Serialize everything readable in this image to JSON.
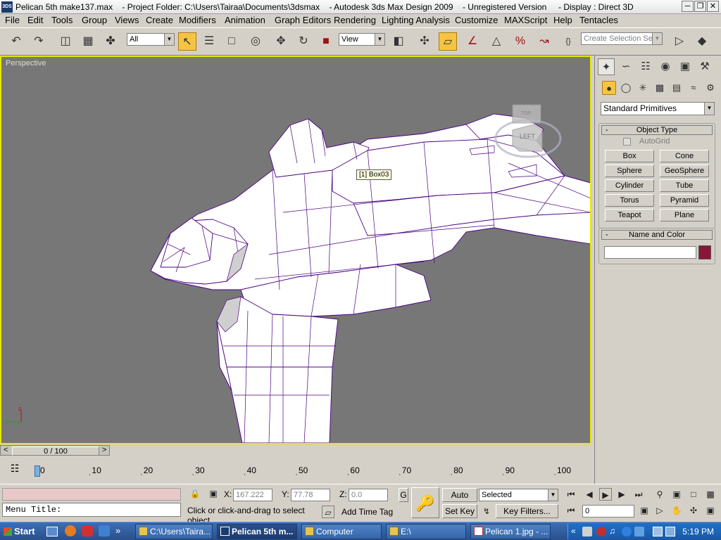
{
  "window": {
    "app_icon": "3DS",
    "title": "Pelican 5th make137.max    - Project Folder: C:\\Users\\Tairaa\\Documents\\3dsmax    - Autodesk 3ds Max Design 2009    - Unregistered Version     - Display : Direct 3D"
  },
  "menu": [
    "File",
    "Edit",
    "Tools",
    "Group",
    "Views",
    "Create",
    "Modifiers",
    "Animation",
    "Graph Editors",
    "Rendering",
    "Lighting Analysis",
    "Customize",
    "MAXScript",
    "Help",
    "Tentacles"
  ],
  "toolbar": {
    "selection_filter": "All",
    "ref_coord": "View",
    "named_selection_placeholder": "Create Selection Set",
    "icons": [
      "undo-icon",
      "redo-icon",
      "select-link-icon",
      "unlink-icon",
      "bind-spacewarp-icon",
      "select-object-icon",
      "select-by-name-icon",
      "rect-region-icon",
      "window-crossing-icon",
      "move-icon",
      "rotate-icon",
      "scale-icon",
      "pivot-icon",
      "manipulate-icon",
      "snap-toggle-icon",
      "angle-snap-icon",
      "percent-snap-icon",
      "spinner-snap-icon",
      "edit-named-sel-icon",
      "mirror-icon",
      "align-icon"
    ]
  },
  "viewport": {
    "label": "Perspective",
    "tooltip": "[1] Box03",
    "gizmo_z": "z",
    "gizmo_y": "y",
    "viewcube_face": "LEFT",
    "viewcube_top": "TOP"
  },
  "command_panel": {
    "category": "Standard Primitives",
    "object_type_header": "Object Type",
    "autogrid_label": "AutoGrid",
    "autogrid_checked": false,
    "buttons": [
      "Box",
      "Cone",
      "Sphere",
      "GeoSphere",
      "Cylinder",
      "Tube",
      "Torus",
      "Pyramid",
      "Teapot",
      "Plane"
    ],
    "name_color_header": "Name and Color",
    "object_name": "",
    "object_color": "#8b1538",
    "collapse_symbol": "-"
  },
  "timeline": {
    "frame_display": "0 / 100",
    "ticks": [
      "0",
      "10",
      "20",
      "30",
      "40",
      "50",
      "60",
      "70",
      "80",
      "90",
      "100"
    ],
    "prev_arrow": "<",
    "next_arrow": ">"
  },
  "status": {
    "maxscript_label": "Menu Title:",
    "x_label": "X:",
    "x_value": "167.222",
    "y_label": "Y:",
    "y_value": "77.78",
    "z_label": "Z:",
    "z_value": "0.0",
    "grid_label": "G",
    "prompt": "Click or click-and-drag to select object",
    "add_time_tag": "Add Time Tag",
    "auto_key": "Auto Key",
    "set_key": "Set Key",
    "key_mode": "Selected",
    "key_filters": "Key Filters...",
    "current_frame": "0"
  },
  "taskbar": {
    "start": "Start",
    "tasks": [
      "C:\\Users\\Taira...",
      "Pelican 5th m...",
      "Computer",
      "E:\\",
      "Pelican 1.jpg - ..."
    ],
    "clock": "5:19 PM"
  },
  "colors": {
    "viewport_bg": "#777777",
    "active_border": "#e8e800",
    "wire": "#4b0082",
    "highlight": "#f5c542"
  }
}
